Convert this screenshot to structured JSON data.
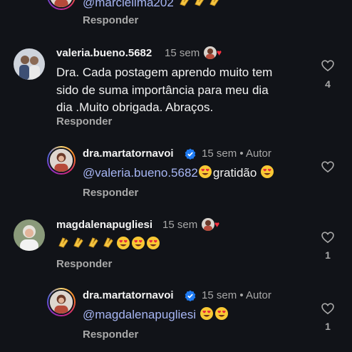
{
  "top": {
    "mention": "@marcielima202",
    "emojis": [
      "clap",
      "clap",
      "clap"
    ],
    "reply_label": "Responder"
  },
  "comments": [
    {
      "username": "valeria.bueno.5682",
      "time": "15 sem",
      "text_line1": "Dra. Cada postagem aprendo muito tem",
      "text_line2": "sido de suma importância para meu dia",
      "text_line3": "dia .Muito obrigada. Abraços.",
      "reply_label": "Responder",
      "likes": "4"
    },
    {
      "username": "dra.martatornavoi",
      "time": "15 sem",
      "author_label": "Autor",
      "separator": "•",
      "mention": "@valeria.bueno.5682",
      "text": "gratidão",
      "reply_label": "Responder"
    },
    {
      "username": "magdalenapugliesi",
      "time": "15 sem",
      "reply_label": "Responder",
      "likes": "1"
    },
    {
      "username": "dra.martatornavoi",
      "time": "15 sem",
      "author_label": "Autor",
      "separator": "•",
      "mention": "@magdalenapugliesi",
      "reply_label": "Responder",
      "likes": "1"
    }
  ],
  "colors": {
    "background": "#111318",
    "mention": "#a7b6f4",
    "verified": "#1f7bf2",
    "heart": "#ff3040"
  }
}
